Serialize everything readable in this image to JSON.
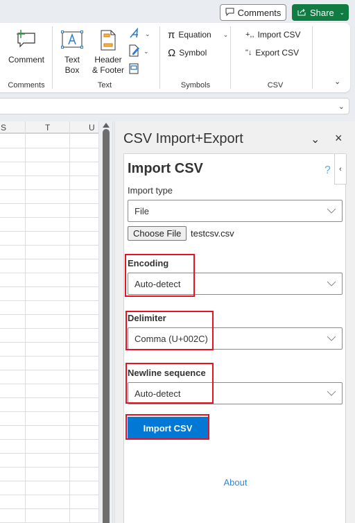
{
  "topbar": {
    "comments_label": "Comments",
    "share_label": "Share"
  },
  "ribbon": {
    "groups": {
      "comments": {
        "label": "Comments",
        "comment_button": "Comment"
      },
      "text": {
        "label": "Text",
        "text_box_line1": "Text",
        "text_box_line2": "Box",
        "header_footer_line1": "Header",
        "header_footer_line2": "& Footer"
      },
      "symbols": {
        "label": "Symbols",
        "equation": "Equation",
        "symbol": "Symbol"
      },
      "csv": {
        "label": "CSV",
        "import_csv": "Import CSV",
        "export_csv": "Export CSV"
      }
    }
  },
  "sheet": {
    "columns": [
      "S",
      "T",
      "U"
    ]
  },
  "task_pane": {
    "title": "CSV Import+Export",
    "heading": "Import CSV",
    "help_glyph": "?",
    "import_type": {
      "label": "Import type",
      "value": "File"
    },
    "file_input": {
      "button_label": "Choose File",
      "file_name": "testcsv.csv"
    },
    "encoding": {
      "label": "Encoding",
      "value": "Auto-detect"
    },
    "delimiter": {
      "label": "Delimiter",
      "value": "Comma (U+002C)"
    },
    "newline": {
      "label": "Newline sequence",
      "value": "Auto-detect"
    },
    "import_button": "Import CSV",
    "about_link": "About"
  },
  "colors": {
    "share_green": "#107c41",
    "primary_blue": "#0078d4",
    "link_blue": "#2b88d8",
    "highlight_red": "#e81123"
  }
}
